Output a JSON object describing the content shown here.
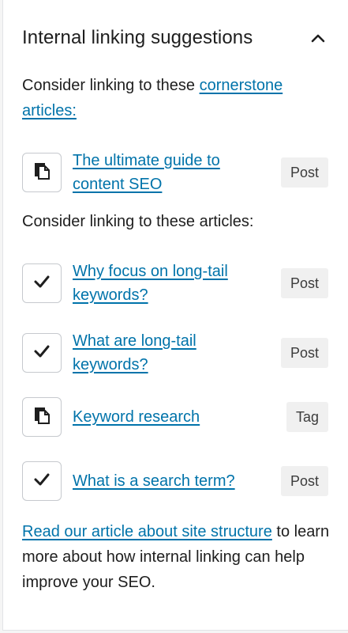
{
  "panel": {
    "title": "Internal linking suggestions",
    "toggle_icon": "chevron-up-icon"
  },
  "cornerstone": {
    "intro_text": "Consider linking to these ",
    "intro_link": "cornerstone articles:",
    "items": [
      {
        "title": "The ultimate guide to content SEO",
        "type": "Post",
        "icon": "copy-icon"
      }
    ]
  },
  "articles": {
    "intro_text": "Consider linking to these articles:",
    "items": [
      {
        "title": "Why focus on long-tail keywords?",
        "type": "Post",
        "icon": "checkmark-icon"
      },
      {
        "title": "What are long-tail keywords?",
        "type": "Post",
        "icon": "checkmark-icon"
      },
      {
        "title": "Keyword research",
        "type": "Tag",
        "icon": "copy-icon"
      },
      {
        "title": "What is a search term?",
        "type": "Post",
        "icon": "checkmark-icon"
      }
    ]
  },
  "footer": {
    "link": "Read our article about site structure",
    "text": " to learn more about how internal linking can help improve your SEO."
  },
  "colors": {
    "link": "#0073aa",
    "text": "#1e1e1e",
    "badge_bg": "#f0f0f0"
  }
}
